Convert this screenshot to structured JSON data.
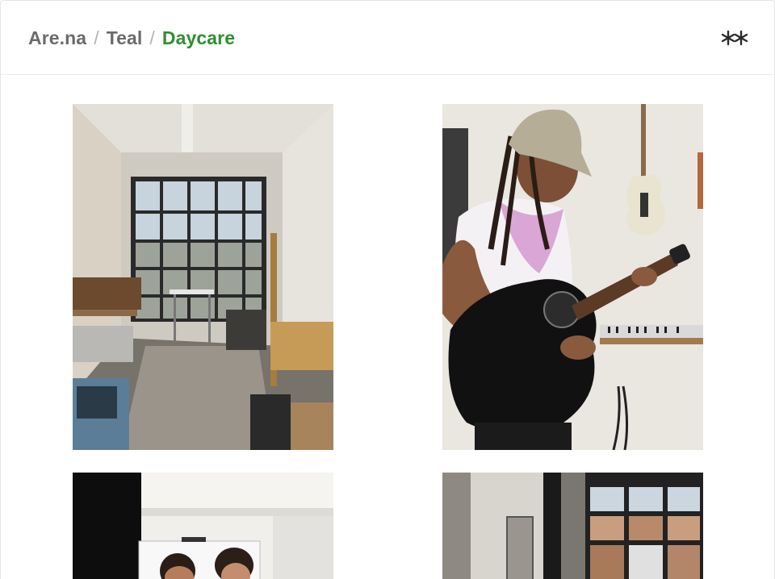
{
  "breadcrumb": {
    "items": [
      {
        "label": "Are.na"
      },
      {
        "label": "Teal"
      },
      {
        "label": "Daycare"
      }
    ],
    "separator": "/"
  },
  "header": {
    "logo_icon": "arena-double-asterisk-logo"
  },
  "colors": {
    "crumb": "#6b6b6b",
    "current_crumb": "#2f8f2f",
    "separator": "#b3b3b3"
  },
  "blocks": [
    {
      "image": "studio-workshop-photo"
    },
    {
      "image": "person-playing-acoustic-guitar-photo"
    },
    {
      "image": "two-people-in-studio-photo"
    },
    {
      "image": "studio-window-photo"
    }
  ]
}
